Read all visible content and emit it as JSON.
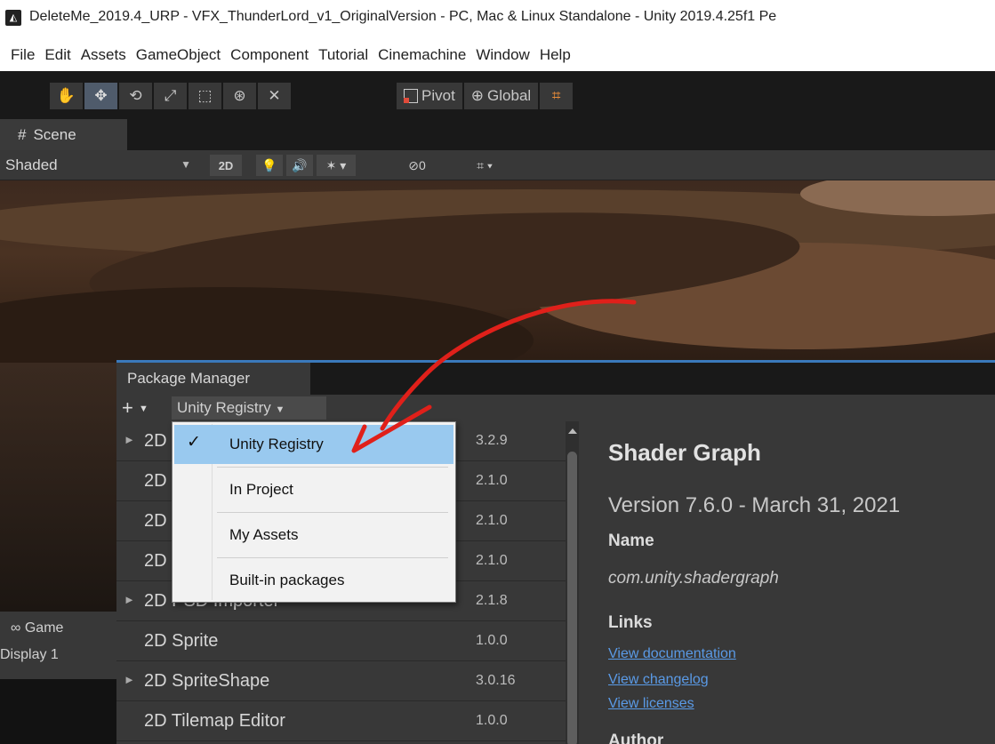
{
  "window": {
    "app_icon": "unity-icon",
    "title": "DeleteMe_2019.4_URP - VFX_ThunderLord_v1_OriginalVersion - PC, Mac & Linux Standalone - Unity 2019.4.25f1 Pe"
  },
  "menubar": {
    "items": [
      "File",
      "Edit",
      "Assets",
      "GameObject",
      "Component",
      "Tutorial",
      "Cinemachine",
      "Window",
      "Help"
    ]
  },
  "toolbar": {
    "tools": [
      {
        "name": "hand-tool-icon",
        "glyph": "✋"
      },
      {
        "name": "move-tool-icon",
        "glyph": "✥"
      },
      {
        "name": "rotate-tool-icon",
        "glyph": "⟲"
      },
      {
        "name": "scale-tool-icon",
        "glyph": "⤢"
      },
      {
        "name": "rect-tool-icon",
        "glyph": "⬚"
      },
      {
        "name": "transform-tool-icon",
        "glyph": "⊛"
      },
      {
        "name": "custom-tool-icon",
        "glyph": "✕"
      }
    ],
    "pivot_label": "Pivot",
    "global_label": "Global",
    "grid_snap_icon": "grid-snap-icon"
  },
  "scene": {
    "tab_label": "Scene",
    "tab_icon": "#",
    "shading_mode": "Shaded",
    "toggle_2d": "2D",
    "hidden_count": "0"
  },
  "game": {
    "tab_label": "Game",
    "display": "Display 1"
  },
  "package_manager": {
    "tab_label": "Package Manager",
    "add_button": "+",
    "source_button": "Unity Registry",
    "packages": [
      {
        "name": "2D",
        "version": "3.2.9",
        "expandable": true
      },
      {
        "name": "2D",
        "version": "2.1.0",
        "expandable": false
      },
      {
        "name": "2D",
        "version": "2.1.0",
        "expandable": false
      },
      {
        "name": "2D",
        "version": "2.1.0",
        "expandable": false
      },
      {
        "name": "2D PSD Importer",
        "version": "2.1.8",
        "expandable": true
      },
      {
        "name": "2D Sprite",
        "version": "1.0.0",
        "expandable": false
      },
      {
        "name": "2D SpriteShape",
        "version": "3.0.16",
        "expandable": true
      },
      {
        "name": "2D Tilemap Editor",
        "version": "1.0.0",
        "expandable": false
      }
    ],
    "details": {
      "title": "Shader Graph",
      "version": "Version 7.6.0 - March 31, 2021",
      "name_label": "Name",
      "name": "com.unity.shadergraph",
      "links_label": "Links",
      "links": [
        "View documentation",
        "View changelog",
        "View licenses"
      ],
      "author_label": "Author"
    }
  },
  "dropdown": {
    "items": [
      "Unity Registry",
      "In Project",
      "My Assets",
      "Built-in packages"
    ],
    "selected": "Unity Registry"
  },
  "colors": {
    "accent_blue": "#3a79bb",
    "selection": "#99c9ef",
    "link": "#5a9ae6",
    "annotation_arrow": "#e0201a"
  }
}
